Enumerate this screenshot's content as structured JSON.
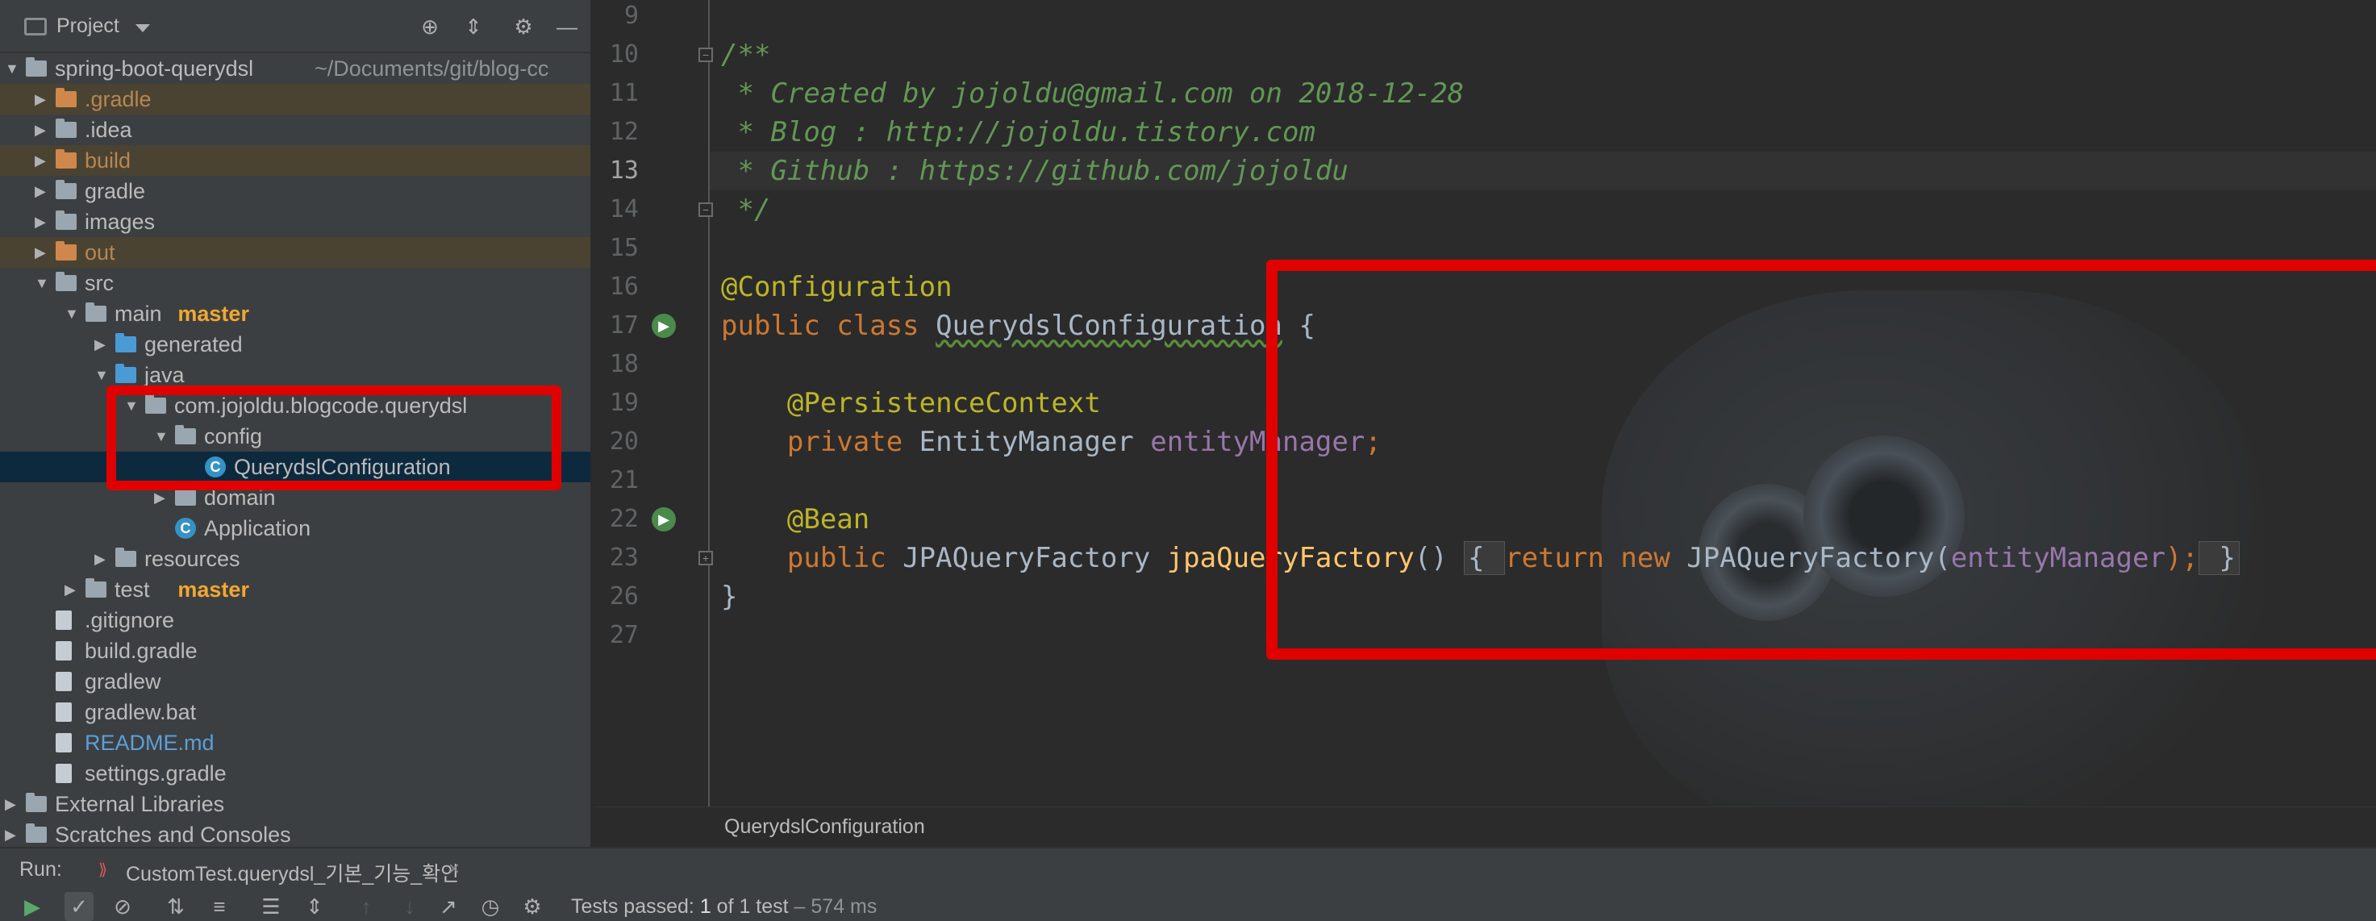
{
  "project_panel": {
    "title": "Project",
    "tree": [
      {
        "label": "spring-boot-querydsl",
        "hint": "~/Documents/git/blog-cc",
        "kind": "module",
        "indent": 0,
        "expanded": true
      },
      {
        "label": ".gradle",
        "kind": "folder-orange",
        "indent": 1,
        "expanded": false,
        "excluded": true
      },
      {
        "label": ".idea",
        "kind": "folder-grey",
        "indent": 1,
        "expanded": false
      },
      {
        "label": "build",
        "kind": "folder-orange",
        "indent": 1,
        "expanded": false,
        "excluded": true
      },
      {
        "label": "gradle",
        "kind": "folder-grey",
        "indent": 1,
        "expanded": false
      },
      {
        "label": "images",
        "kind": "folder-grey",
        "indent": 1,
        "expanded": false
      },
      {
        "label": "out",
        "kind": "folder-orange",
        "indent": 1,
        "expanded": false,
        "excluded": true
      },
      {
        "label": "src",
        "kind": "folder-grey",
        "indent": 1,
        "expanded": true
      },
      {
        "label": "main",
        "branch": "master",
        "kind": "folder-grey",
        "indent": 2,
        "expanded": true
      },
      {
        "label": "generated",
        "kind": "folder-blue",
        "indent": 3,
        "expanded": false
      },
      {
        "label": "java",
        "kind": "folder-blue",
        "indent": 3,
        "expanded": true
      },
      {
        "label": "com.jojoldu.blogcode.querydsl",
        "kind": "package",
        "indent": 4,
        "expanded": true
      },
      {
        "label": "config",
        "kind": "package",
        "indent": 5,
        "expanded": true
      },
      {
        "label": "QuerydslConfiguration",
        "kind": "class",
        "indent": 6,
        "selected": true
      },
      {
        "label": "domain",
        "kind": "package",
        "indent": 5,
        "expanded": false
      },
      {
        "label": "Application",
        "kind": "class-app",
        "indent": 5
      },
      {
        "label": "resources",
        "kind": "folder-res",
        "indent": 3,
        "expanded": false
      },
      {
        "label": "test",
        "branch": "master",
        "kind": "folder-grey",
        "indent": 2,
        "expanded": false
      },
      {
        "label": ".gitignore",
        "kind": "file",
        "indent": 1
      },
      {
        "label": "build.gradle",
        "kind": "file",
        "indent": 1
      },
      {
        "label": "gradlew",
        "kind": "file",
        "indent": 1
      },
      {
        "label": "gradlew.bat",
        "kind": "file",
        "indent": 1
      },
      {
        "label": "README.md",
        "kind": "file-md",
        "indent": 1
      },
      {
        "label": "settings.gradle",
        "kind": "file",
        "indent": 1
      },
      {
        "label": "External Libraries",
        "kind": "libs",
        "indent": 0,
        "expanded": false
      },
      {
        "label": "Scratches and Consoles",
        "kind": "scratch",
        "indent": 0,
        "expanded": false
      }
    ]
  },
  "editor": {
    "current_line": "13",
    "lines": [
      {
        "num": "9",
        "html": ""
      },
      {
        "num": "10",
        "segments": [
          {
            "t": "/**",
            "c": "c-comment"
          }
        ]
      },
      {
        "num": "11",
        "segments": [
          {
            "t": " * Created by jojoldu@gmail.com on 2018-12-28",
            "c": "c-comment"
          }
        ]
      },
      {
        "num": "12",
        "segments": [
          {
            "t": " * Blog : http://jojoldu.tistory.com",
            "c": "c-comment"
          }
        ]
      },
      {
        "num": "13",
        "segments": [
          {
            "t": " * Github : https://github.com/jojoldu",
            "c": "c-comment"
          }
        ]
      },
      {
        "num": "14",
        "segments": [
          {
            "t": " */",
            "c": "c-comment"
          }
        ]
      },
      {
        "num": "15",
        "segments": []
      },
      {
        "num": "16",
        "segments": [
          {
            "t": "@Configuration",
            "c": "c-anno"
          }
        ]
      },
      {
        "num": "17",
        "segments": [
          {
            "t": "public class ",
            "c": "c-kw"
          },
          {
            "t": "QuerydslConfiguration",
            "c": "c-class"
          },
          {
            "t": " {",
            "c": ""
          }
        ]
      },
      {
        "num": "18",
        "segments": []
      },
      {
        "num": "19",
        "segments": [
          {
            "t": "    ",
            "c": ""
          },
          {
            "t": "@PersistenceContext",
            "c": "c-anno"
          }
        ]
      },
      {
        "num": "20",
        "segments": [
          {
            "t": "    ",
            "c": ""
          },
          {
            "t": "private ",
            "c": "c-kw"
          },
          {
            "t": "EntityManager ",
            "c": ""
          },
          {
            "t": "entityManager",
            "c": "c-field"
          },
          {
            "t": ";",
            "c": "c-kw"
          }
        ]
      },
      {
        "num": "21",
        "segments": []
      },
      {
        "num": "22",
        "segments": [
          {
            "t": "    ",
            "c": ""
          },
          {
            "t": "@Bean",
            "c": "c-anno"
          }
        ]
      },
      {
        "num": "23",
        "segments": [
          {
            "t": "    ",
            "c": ""
          },
          {
            "t": "public ",
            "c": "c-kw"
          },
          {
            "t": "JPAQueryFactory ",
            "c": ""
          },
          {
            "t": "jpaQueryFactory",
            "c": "c-method"
          },
          {
            "t": "() ",
            "c": ""
          },
          {
            "t": "{ ",
            "c": "c-fold"
          },
          {
            "t": "return new ",
            "c": "c-kw"
          },
          {
            "t": "JPAQueryFactory(",
            "c": ""
          },
          {
            "t": "entityManager",
            "c": "c-field"
          },
          {
            "t": ");",
            "c": "c-kw"
          },
          {
            "t": " }",
            "c": "c-fold"
          }
        ]
      },
      {
        "num": "26",
        "segments": [
          {
            "t": "}",
            "c": ""
          }
        ]
      },
      {
        "num": "27",
        "segments": []
      }
    ],
    "breadcrumb": "QuerydslConfiguration"
  },
  "run": {
    "label": "Run:",
    "tab_label": "CustomTest.querydsl_기본_기능_확인",
    "status_prefix": "Tests passed: ",
    "status_count": "1",
    "status_mid": " of 1 test",
    "status_time": " – 574 ms"
  },
  "icons": {
    "header_tools": [
      "crosshair-icon",
      "collapse-icon",
      "gear-icon",
      "minimize-icon"
    ],
    "run_toolbar": [
      "play-icon",
      "check-icon",
      "stop-icon",
      "sort-alpha-icon",
      "sort-duration-icon",
      "expand-all-icon",
      "collapse-all-icon",
      "up-icon",
      "down-icon",
      "export-icon",
      "history-icon",
      "settings-icon"
    ]
  },
  "colors": {
    "highlight_box": "#e00000",
    "selection": "#0d293e",
    "branch": "#f0a732"
  }
}
